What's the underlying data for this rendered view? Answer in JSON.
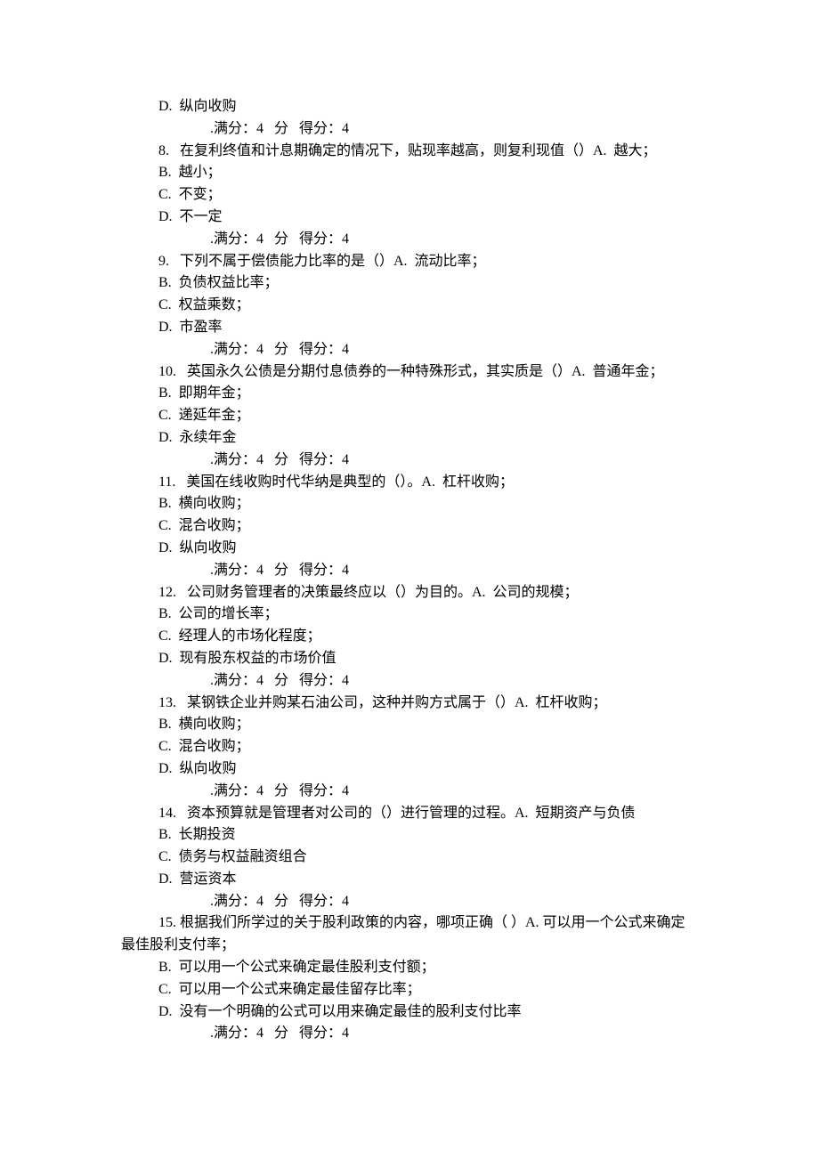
{
  "score_line": ".满分：4   分   得分：4",
  "questions": [
    {
      "pre_options": [
        "D.  纵向收购"
      ],
      "stem": "8.   在复利终值和计息期确定的情况下，贴现率越高，则复利现值（）A.  越大；",
      "options": [
        "B.  越小；",
        "C.  不变；",
        "D.  不一定"
      ]
    },
    {
      "stem": "9.   下列不属于偿债能力比率的是（）A.  流动比率；",
      "options": [
        "B.  负债权益比率；",
        "C.  权益乘数；",
        "D.  市盈率"
      ]
    },
    {
      "stem": "10.   英国永久公债是分期付息债券的一种特殊形式，其实质是（）A.  普通年金；",
      "options": [
        "B.  即期年金；",
        "C.  递延年金；",
        "D.  永续年金"
      ]
    },
    {
      "stem": "11.   美国在线收购时代华纳是典型的（）。A.  杠杆收购；",
      "options": [
        "B.  横向收购；",
        "C.  混合收购；",
        "D.  纵向收购"
      ]
    },
    {
      "stem": "12.   公司财务管理者的决策最终应以（）为目的。A.  公司的规模；",
      "options": [
        "B.  公司的增长率；",
        "C.  经理人的市场化程度；",
        "D.  现有股东权益的市场价值"
      ]
    },
    {
      "stem": "13.   某钢铁企业并购某石油公司，这种并购方式属于（）A.  杠杆收购；",
      "options": [
        "B.  横向收购；",
        "C.  混合收购；",
        "D.  纵向收购"
      ]
    },
    {
      "stem": "14.   资本预算就是管理者对公司的（）进行管理的过程。A.  短期资产与负债",
      "options": [
        "B.  长期投资",
        "C.  债务与权益融资组合",
        "D.  营运资本"
      ]
    },
    {
      "stem_wrap": "15.   根据我们所学过的关于股利政策的内容，哪项正确（  ）A.  可以用一个公式来确定最佳股利支付率；",
      "options": [
        "B.  可以用一个公式来确定最佳股利支付额；",
        "C.  可以用一个公式来确定最佳留存比率；",
        "D.  没有一个明确的公式可以用来确定最佳的股利支付比率"
      ]
    }
  ]
}
